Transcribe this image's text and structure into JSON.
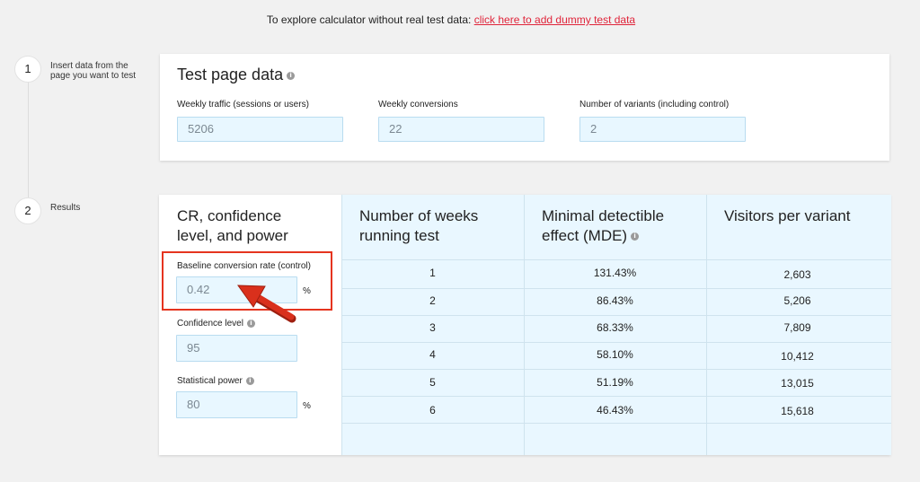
{
  "top_note": {
    "text": "To explore calculator without real test data:",
    "link": "click here to add dummy test data"
  },
  "steps": [
    {
      "number": "1",
      "label": "Insert data from the page you want to test"
    },
    {
      "number": "2",
      "label": "Results"
    }
  ],
  "test_page": {
    "title": "Test page data",
    "fields": [
      {
        "label": "Weekly traffic (sessions or users)",
        "value": "5206"
      },
      {
        "label": "Weekly conversions",
        "value": "22"
      },
      {
        "label": "Number of variants (including control)",
        "value": "2"
      }
    ]
  },
  "results": {
    "left_title_line1": "CR, confidence",
    "left_title_line2": "level, and power",
    "baseline_label": "Baseline conversion rate (control)",
    "baseline_value": "0.42",
    "baseline_unit": "%",
    "confidence_label": "Confidence level",
    "confidence_value": "95",
    "power_label": "Statistical power",
    "power_value": "80",
    "power_unit": "%",
    "columns": [
      {
        "line1": "Number of weeks",
        "line2": "running test"
      },
      {
        "line1": "Minimal detectible",
        "line2": "effect (MDE)"
      },
      {
        "line1": "Visitors per variant",
        "line2": ""
      }
    ],
    "rows": [
      {
        "weeks": "1",
        "mde": "131.43%",
        "visitors": "2,603"
      },
      {
        "weeks": "2",
        "mde": "86.43%",
        "visitors": "5,206"
      },
      {
        "weeks": "3",
        "mde": "68.33%",
        "visitors": "7,809"
      },
      {
        "weeks": "4",
        "mde": "58.10%",
        "visitors": "10,412"
      },
      {
        "weeks": "5",
        "mde": "51.19%",
        "visitors": "13,015"
      },
      {
        "weeks": "6",
        "mde": "46.43%",
        "visitors": "15,618"
      }
    ]
  },
  "colors": {
    "accent_link": "#e0243a",
    "field_bg": "#e8f7ff",
    "highlight": "#e5341f",
    "arrow": "#d9301c"
  }
}
